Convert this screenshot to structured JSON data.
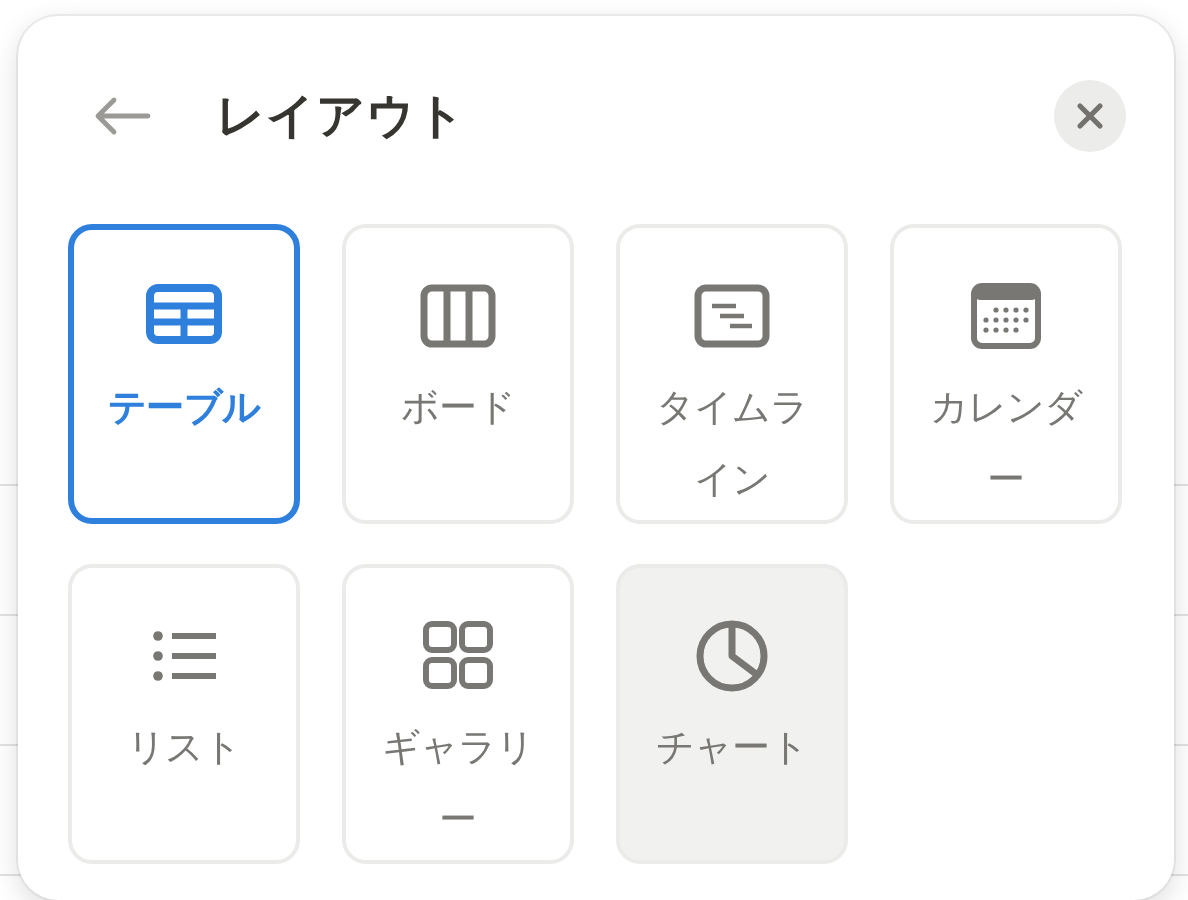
{
  "panel": {
    "title": "レイアウト",
    "layouts": [
      {
        "kind": "table",
        "label": "テーブル",
        "selected": true,
        "hovered": false
      },
      {
        "kind": "board",
        "label": "ボード",
        "selected": false,
        "hovered": false
      },
      {
        "kind": "timeline",
        "label": "タイムライン",
        "selected": false,
        "hovered": false
      },
      {
        "kind": "calendar",
        "label": "カレンダー",
        "selected": false,
        "hovered": false
      },
      {
        "kind": "list",
        "label": "リスト",
        "selected": false,
        "hovered": false
      },
      {
        "kind": "gallery",
        "label": "ギャラリー",
        "selected": false,
        "hovered": false
      },
      {
        "kind": "chart",
        "label": "チャート",
        "selected": false,
        "hovered": true
      }
    ]
  }
}
